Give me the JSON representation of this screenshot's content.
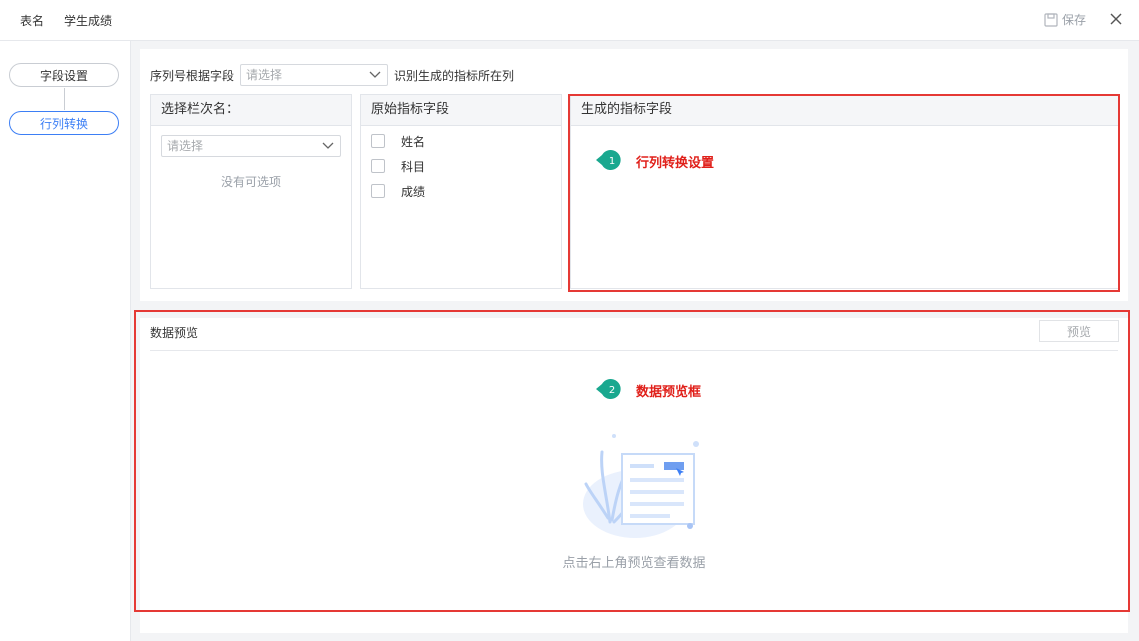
{
  "header": {
    "table_label": "表名",
    "table_name": "学生成绩",
    "save_label": "保存"
  },
  "sidebar": {
    "steps": [
      {
        "label": "字段设置",
        "active": false
      },
      {
        "label": "行列转换",
        "active": true
      }
    ]
  },
  "config": {
    "seq_label": "序列号根据字段",
    "seq_placeholder": "请选择",
    "seq_suffix": "识别生成的指标所在列",
    "col1_title": "选择栏次名：",
    "col1_placeholder": "请选择",
    "col1_empty": "没有可选项",
    "col2_title": "原始指标字段",
    "fields": [
      "姓名",
      "科目",
      "成绩"
    ],
    "col3_title": "生成的指标字段"
  },
  "preview": {
    "title": "数据预览",
    "button_label": "预览",
    "empty_hint": "点击右上角预览查看数据"
  },
  "annotations": [
    {
      "num": "1",
      "text": "行列转换设置"
    },
    {
      "num": "2",
      "text": "数据预览框"
    }
  ],
  "colors": {
    "accent": "#3d7ff5",
    "highlight_red": "#e53935",
    "annotation_green": "#1aa88f",
    "annotation_text": "#e0201a"
  },
  "icons": [
    "save-icon",
    "close-icon",
    "chevron-down-icon",
    "empty-data-illustration"
  ]
}
